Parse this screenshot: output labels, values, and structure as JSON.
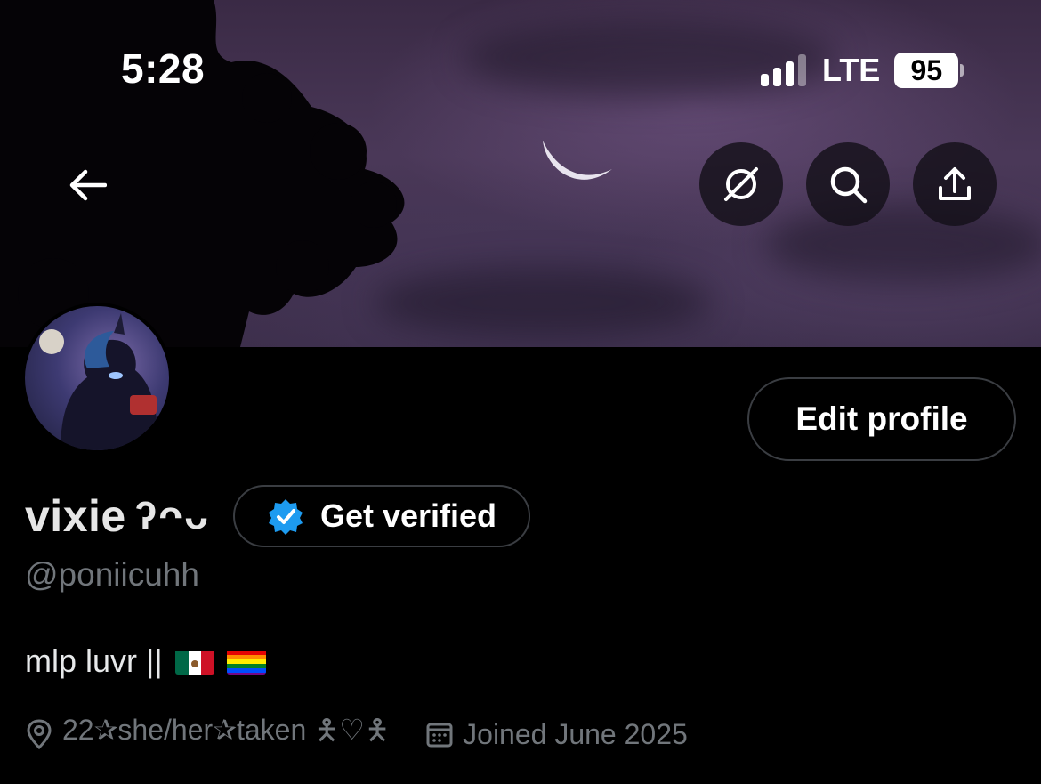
{
  "status_bar": {
    "time": "5:28",
    "network": "LTE",
    "battery": "95"
  },
  "header": {
    "icons": [
      "back-arrow-icon",
      "no-sync-icon",
      "search-icon",
      "share-icon"
    ]
  },
  "profile": {
    "edit_label": "Edit profile",
    "display_name": "vixie",
    "name_decoration": "ʔᴖᴗ",
    "verify_label": "Get verified",
    "handle": "@poniicuhh",
    "bio_text": "mlp luvr ||",
    "bio_flags": [
      "mexico-flag",
      "rainbow-flag"
    ],
    "location": "22✰she/her✰taken 🯅♡🯅",
    "joined": "Joined June 2025"
  },
  "colors": {
    "background": "#000000",
    "muted": "#71767b",
    "border": "#3a3d42",
    "verified_blue": "#1d9bf0"
  }
}
